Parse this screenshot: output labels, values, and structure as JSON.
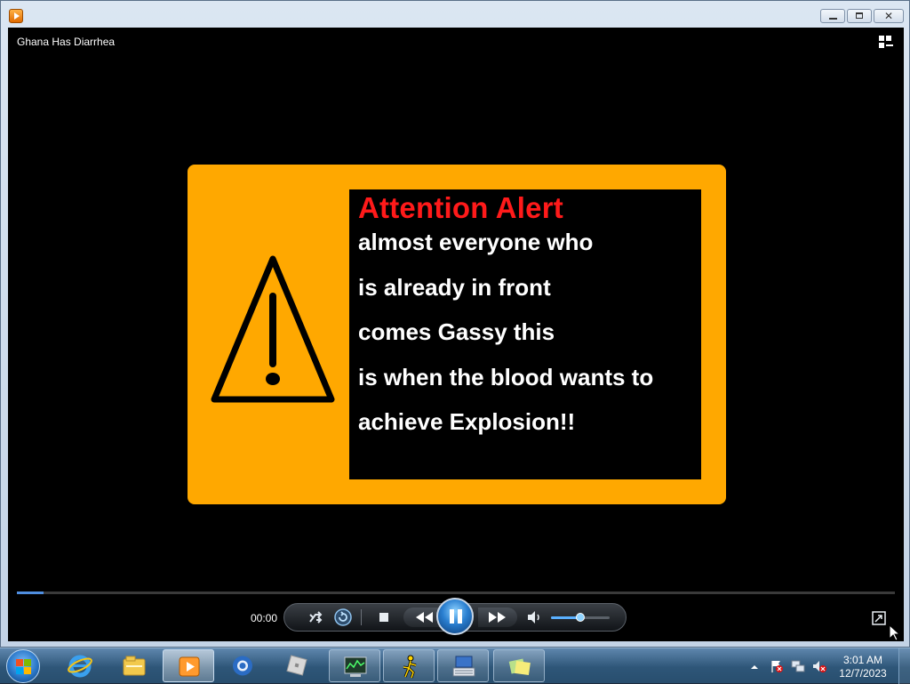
{
  "window": {
    "app_icon": "media-player-icon",
    "minimize_icon": "minimize-icon",
    "maximize_icon": "restore-icon",
    "close_icon": "close-icon",
    "close_glyph": "✕"
  },
  "player": {
    "media_title": "Ghana Has Diarrhea",
    "switch_view_icon": "switch-to-library-icon"
  },
  "video": {
    "heading": "Attention Alert",
    "lines": [
      "almost everyone who",
      "is already in front",
      "comes Gassy this",
      "is when the blood wants to",
      "achieve Explosion!!"
    ],
    "colors": {
      "card": "#ffa800",
      "panel": "#000000",
      "heading": "#ff1a1a",
      "text": "#ffffff"
    },
    "warning_icon": "warning-triangle-icon"
  },
  "controls": {
    "time": "00:00",
    "progress_fraction": 0.03,
    "volume_fraction": 0.5,
    "state": "playing",
    "buttons": [
      "shuffle-icon",
      "repeat-icon",
      "stop-icon",
      "previous-icon",
      "pause-icon",
      "next-icon",
      "volume-icon",
      "fullscreen-icon"
    ]
  },
  "taskbar": {
    "pinned": [
      {
        "name": "internet-explorer-icon",
        "state": "none"
      },
      {
        "name": "file-explorer-icon",
        "state": "none"
      },
      {
        "name": "media-player-icon",
        "state": "active"
      },
      {
        "name": "chrome-icon",
        "state": "none"
      },
      {
        "name": "roblox-icon",
        "state": "none"
      },
      {
        "name": "task-manager-icon",
        "state": "open"
      },
      {
        "name": "aim-icon",
        "state": "open"
      },
      {
        "name": "keyboard-icon",
        "state": "open"
      },
      {
        "name": "sticky-notes-icon",
        "state": "open"
      }
    ],
    "tray": [
      "show-hidden-icons-chevron",
      "action-center-flag-icon",
      "network-icon",
      "volume-muted-icon"
    ],
    "clock_time": "3:01 AM",
    "clock_date": "12/7/2023"
  }
}
